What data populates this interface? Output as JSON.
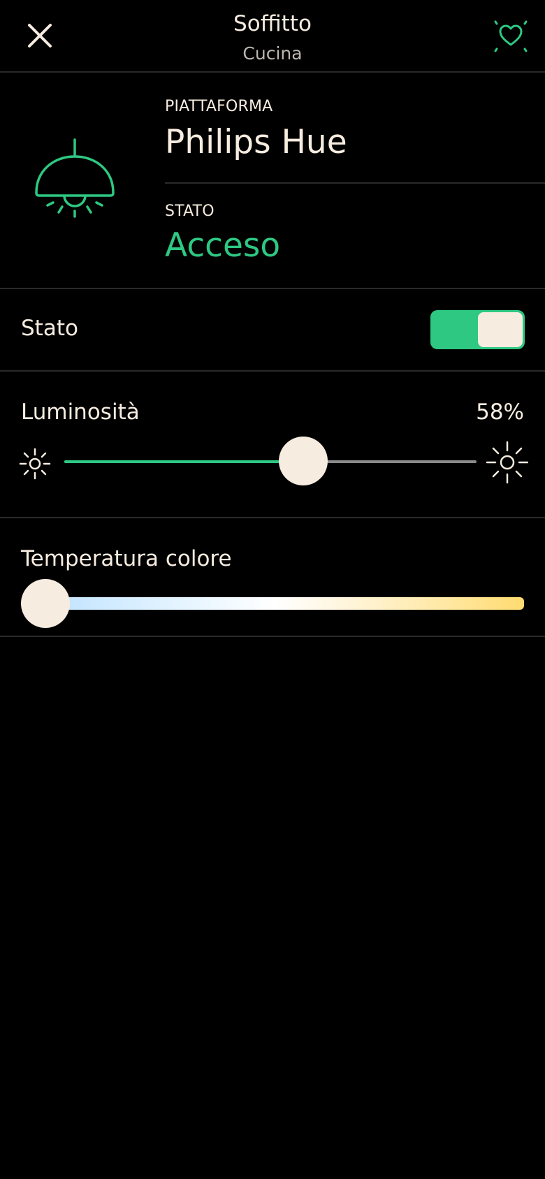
{
  "header": {
    "title": "Soffitto",
    "subtitle": "Cucina",
    "close_icon": "close-icon",
    "favorite_icon": "heart-sparkle-icon"
  },
  "device": {
    "icon": "ceiling-lamp-icon",
    "platform_label": "PIATTAFORMA",
    "platform_value": "Philips Hue",
    "state_label": "STATO",
    "state_value": "Acceso"
  },
  "power": {
    "label": "Stato",
    "on": true
  },
  "brightness": {
    "label": "Luminosità",
    "value_text": "58%",
    "value": 0.58,
    "min_icon": "sun-small-icon",
    "max_icon": "sun-large-icon"
  },
  "color_temperature": {
    "label": "Temperatura colore",
    "value": 0.0
  },
  "colors": {
    "accent": "#2ec882",
    "background": "#000000",
    "text": "#f7ece0",
    "muted_text": "#bdb6ae",
    "divider": "#2a2a2a",
    "track": "#8a8a8a"
  }
}
